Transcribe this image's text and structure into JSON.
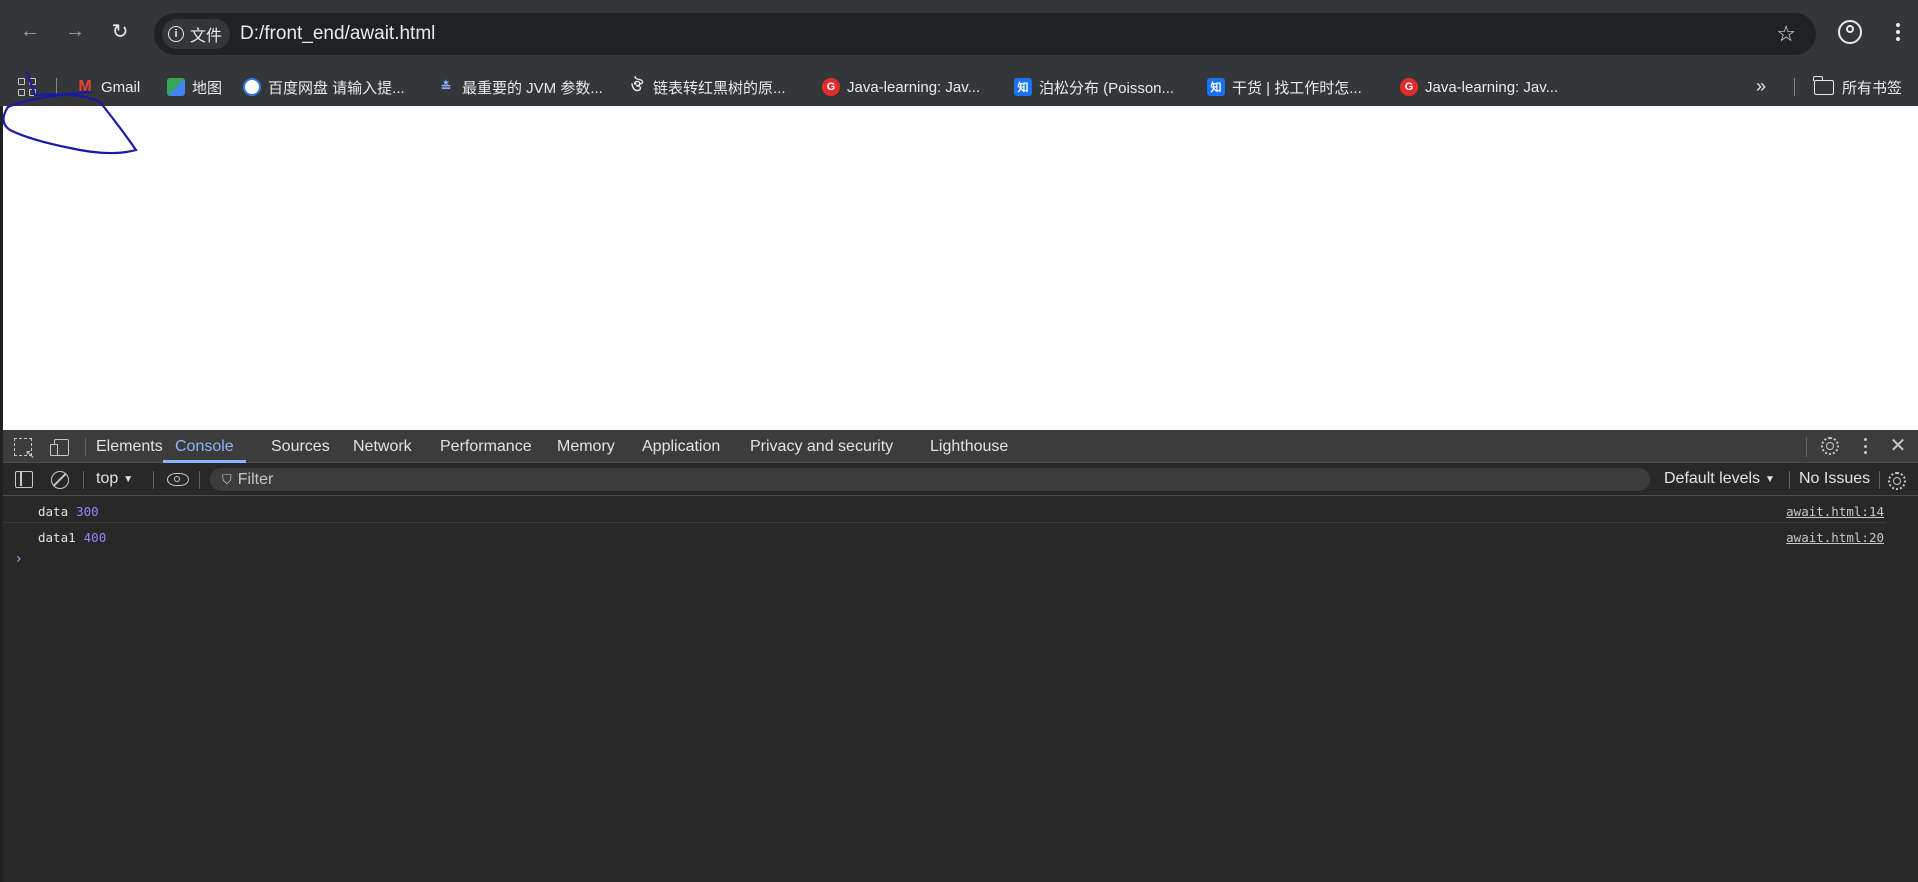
{
  "browser": {
    "url_chip": "文件",
    "url": "D:/front_end/await.html"
  },
  "bookmarks": {
    "items": [
      {
        "label": "Gmail",
        "icon": "gmail-icon",
        "glyph": "M"
      },
      {
        "label": "地图",
        "icon": "maps-icon",
        "glyph": ""
      },
      {
        "label": "百度网盘 请输入提...",
        "icon": "baidu-pan-icon",
        "glyph": ""
      },
      {
        "label": "最重要的 JVM 参数...",
        "icon": "jvm-icon",
        "glyph": "≛"
      },
      {
        "label": "链表转红黑树的原...",
        "icon": "tree-icon",
        "glyph": "ঔ"
      },
      {
        "label": "Java-learning: Jav...",
        "icon": "gitee-icon",
        "glyph": "G"
      },
      {
        "label": "泊松分布 (Poisson...",
        "icon": "zhihu-icon",
        "glyph": "知"
      },
      {
        "label": "干货 | 找工作时怎...",
        "icon": "zhihu-icon",
        "glyph": "知"
      },
      {
        "label": "Java-learning: Jav...",
        "icon": "gitee-icon",
        "glyph": "G"
      }
    ],
    "all_bookmarks": "所有书签"
  },
  "devtools": {
    "tabs": [
      "Elements",
      "Console",
      "Sources",
      "Network",
      "Performance",
      "Memory",
      "Application",
      "Privacy and security",
      "Lighthouse"
    ],
    "active_tab": "Console",
    "context": "top",
    "filter_placeholder": "Filter",
    "levels": "Default levels",
    "issues": "No Issues",
    "logs": [
      {
        "label": "data",
        "value": "300",
        "source": "await.html:14"
      },
      {
        "label": "data1",
        "value": "400",
        "source": "await.html:20"
      }
    ],
    "prompt": "›"
  },
  "colors": {
    "accent": "#8ab4f8",
    "number": "#9980ff",
    "annotation": "#1a1aa6"
  }
}
